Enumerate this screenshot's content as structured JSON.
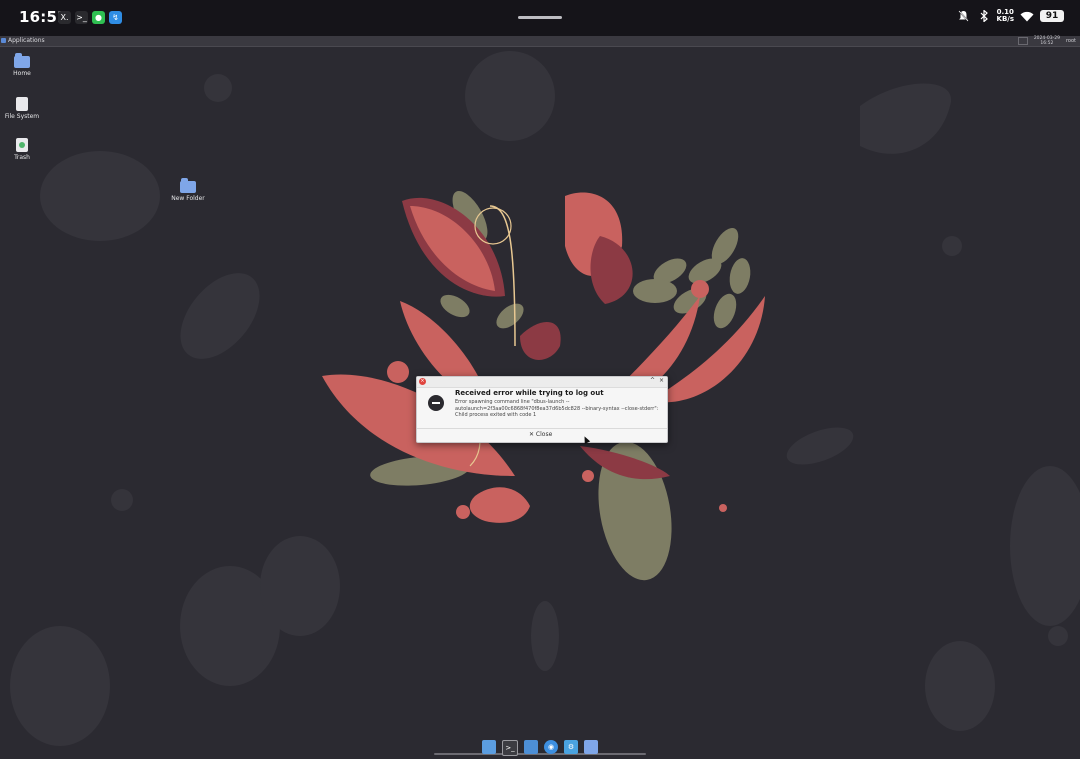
{
  "status_bar": {
    "time": "16:52",
    "apps": [
      {
        "name": "terminal-x",
        "glyph": "X.",
        "color": "#2a2a2e"
      },
      {
        "name": "terminal",
        "glyph": ">_",
        "color": "#2a2a2e"
      },
      {
        "name": "wechat",
        "glyph": "●",
        "color": "#2fbf52"
      },
      {
        "name": "blue-app",
        "glyph": "↯",
        "color": "#2f8de4"
      }
    ],
    "network_speed_value": "0.10",
    "network_speed_unit": "KB/s",
    "battery": "91"
  },
  "panel": {
    "applications_label": "Applications",
    "clock_line1": "2024-03-29",
    "clock_line2": "16:52",
    "user": "root"
  },
  "desktop_icons": [
    {
      "label": "Home",
      "icon": "home-folder-icon"
    },
    {
      "label": "File System",
      "icon": "file-system-icon"
    },
    {
      "label": "Trash",
      "icon": "trash-icon"
    },
    {
      "label": "New Folder",
      "icon": "folder-icon"
    }
  ],
  "dialog": {
    "title": "Received error while trying to log out",
    "message_line1": "Error spawning command line \"dbus-launch --",
    "message_line2": "autolaunch=2f3aa00c6868f470f8ea37d6b5dc828 --binary-syntax --close-stderr\":",
    "message_line3": "Child process exited with code 1",
    "close_label": "✕ Close",
    "wm_buttons": [
      "^",
      "×"
    ]
  },
  "dock": {
    "items": [
      {
        "name": "show-desktop",
        "color": "#5b9de0",
        "glyph": ""
      },
      {
        "name": "terminal",
        "color": "#3c3c42",
        "glyph": ">_"
      },
      {
        "name": "file-manager",
        "color": "#4d8fd6",
        "glyph": ""
      },
      {
        "name": "web-browser",
        "color": "#3d8fe0",
        "glyph": "◉"
      },
      {
        "name": "settings",
        "color": "#4aa3e0",
        "glyph": "⚙"
      },
      {
        "name": "folder",
        "color": "#7fa6e8",
        "glyph": ""
      }
    ]
  },
  "colors": {
    "desktop_bg": "#2b2a31",
    "flower_red": "#c9625f",
    "flower_dark": "#8c3a44",
    "leaf_green": "#7e7d64",
    "gold": "#e8c892"
  }
}
